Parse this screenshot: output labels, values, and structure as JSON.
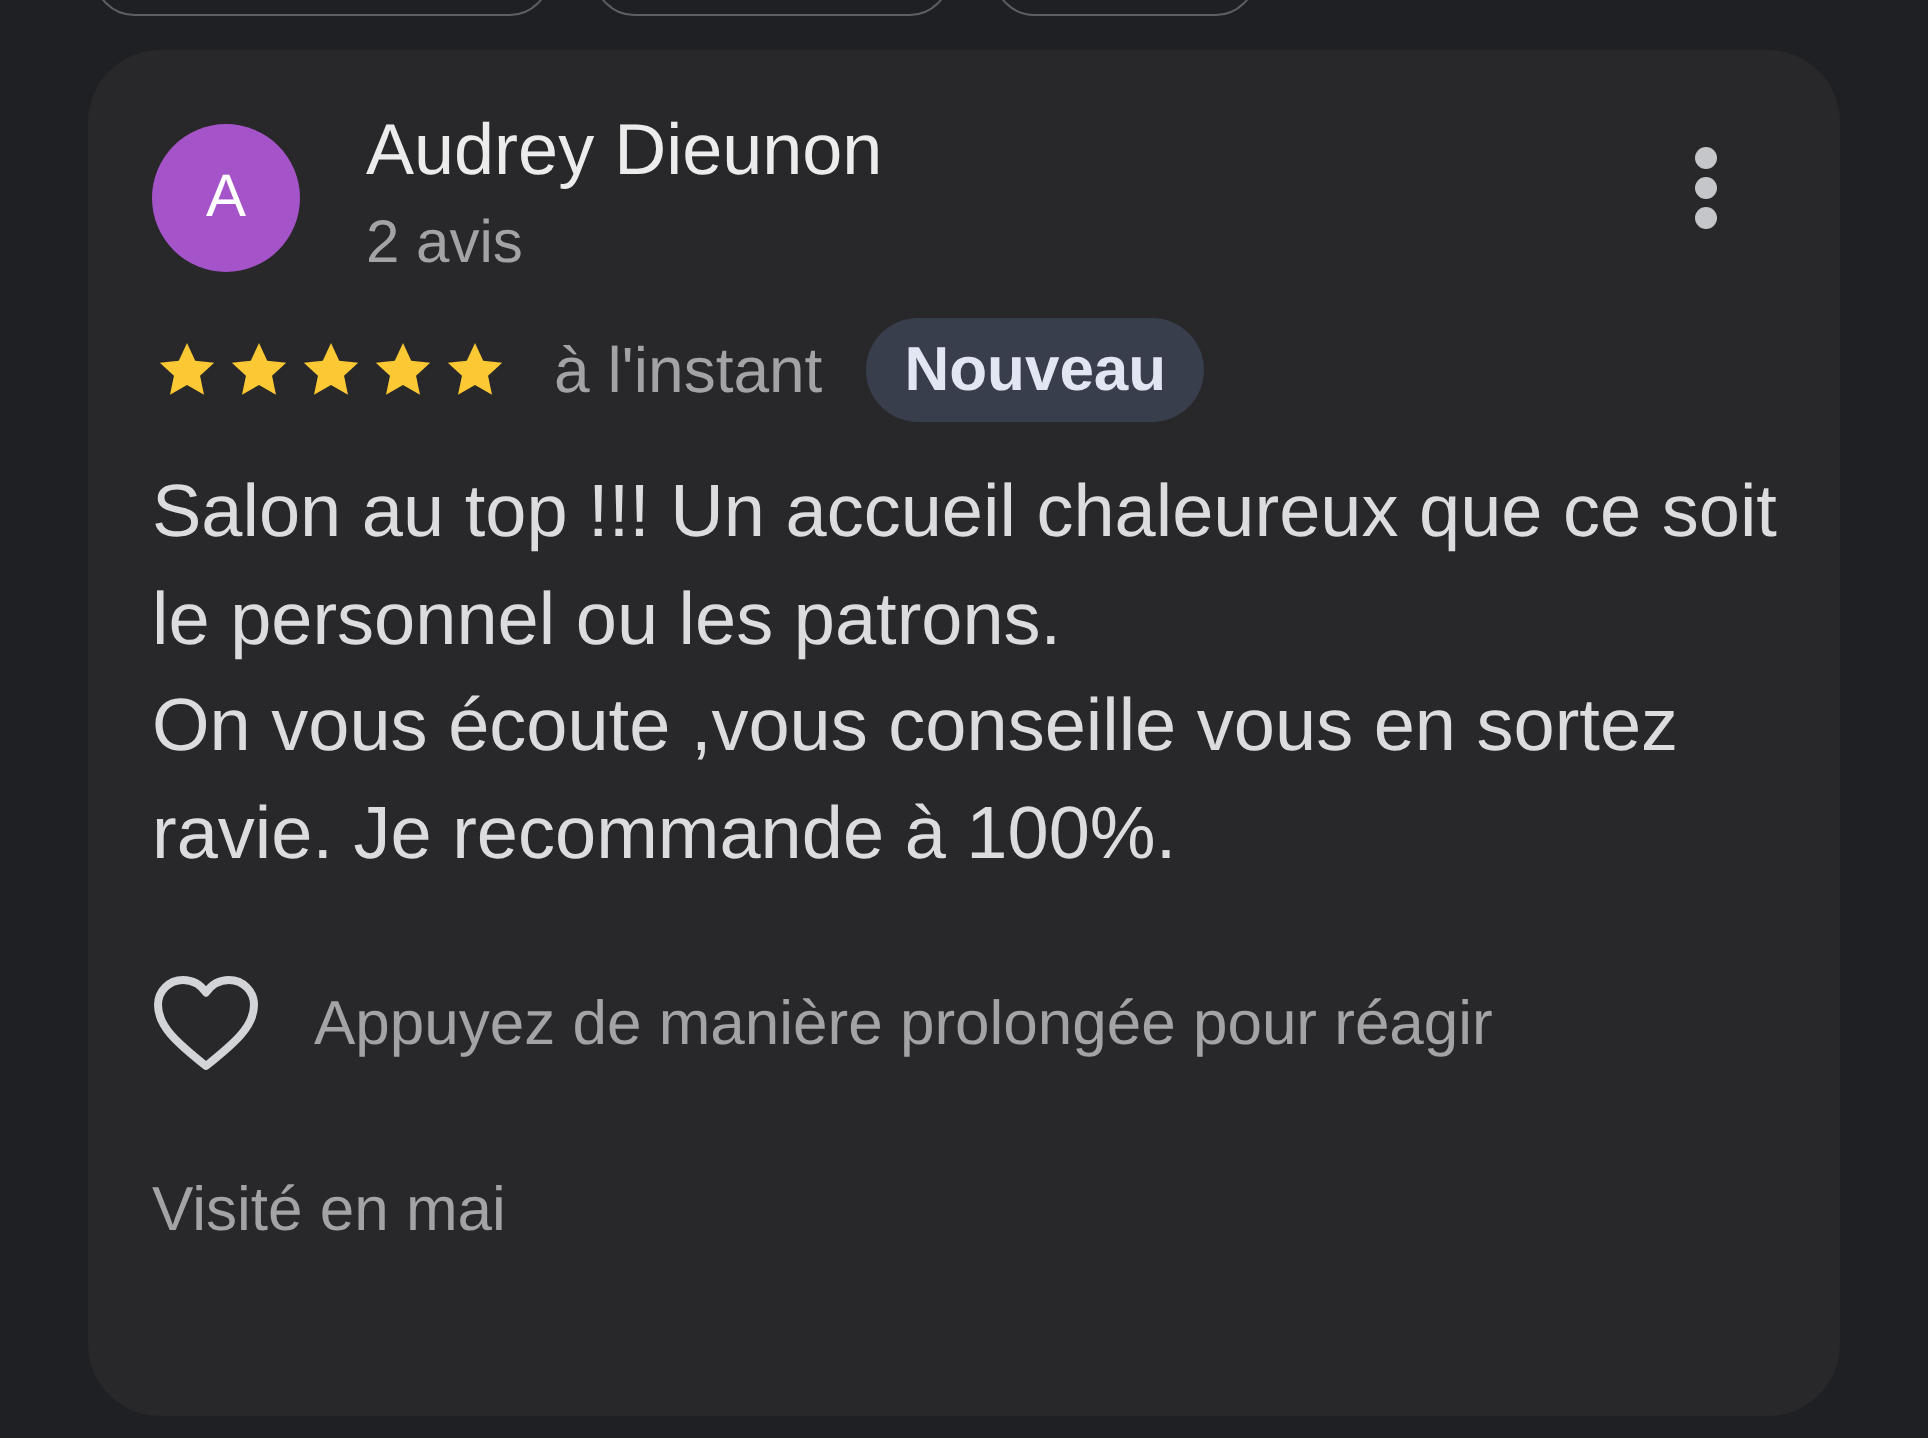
{
  "review": {
    "author": {
      "initial": "A",
      "name": "Audrey Dieunon",
      "count": "2 avis",
      "color": "#a553c8"
    },
    "stars": 5,
    "time": "à l'instant",
    "badge": "Nouveau",
    "text": "Salon au top !!! Un accueil chaleureux que ce soit le personnel ou les patrons.\nOn vous écoute ,vous conseille vous en sortez ravie. Je recommande à 100%.",
    "reaction_hint": "Appuyez de manière prolongée pour réagir",
    "liked": false,
    "visit": "Visité en mai"
  }
}
